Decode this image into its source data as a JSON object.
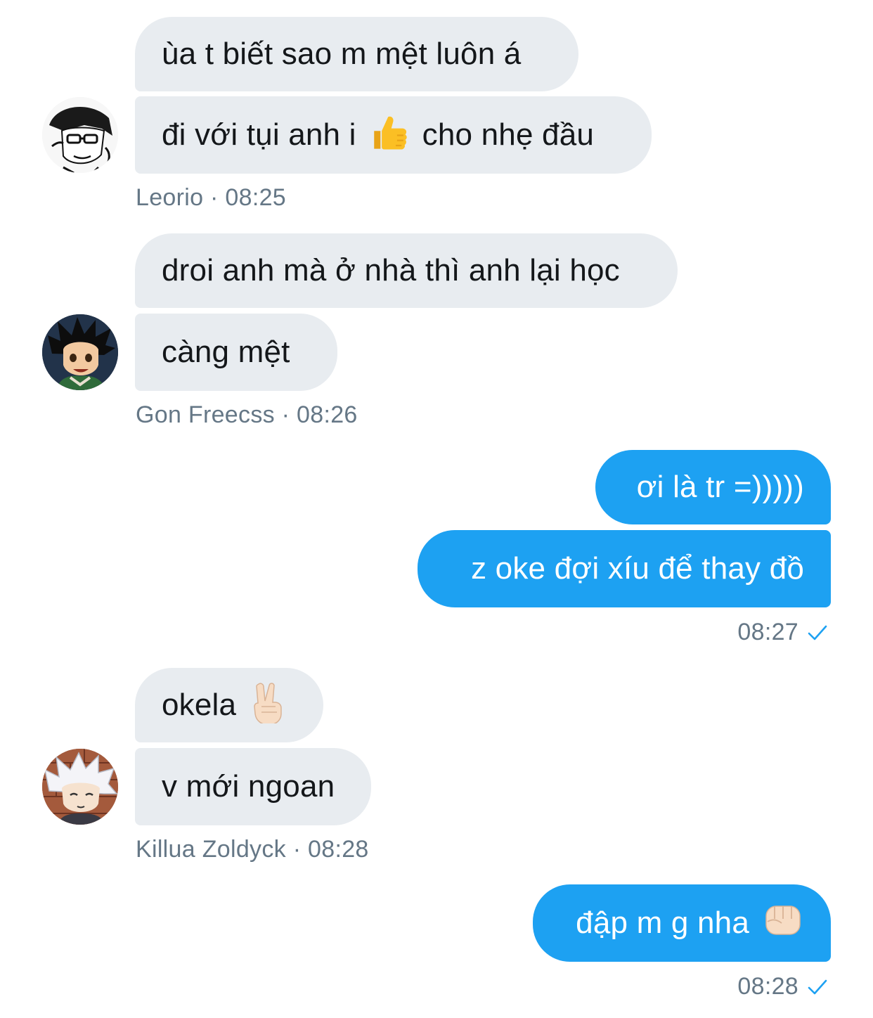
{
  "conversation": {
    "groups": [
      {
        "sender": "Leorio",
        "time": "08:25",
        "meta": "Leorio · 08:25",
        "messages": [
          "ùa t biết sao m mệt luôn á",
          {
            "before": "đi với tụi anh i",
            "emoji": "thumbs-up-icon",
            "after": "cho nhẹ đầu"
          }
        ]
      },
      {
        "sender": "Gon Freecss",
        "time": "08:26",
        "meta": "Gon Freecss · 08:26",
        "messages": [
          "droi anh mà ở nhà thì anh lại học",
          "càng mệt"
        ]
      },
      {
        "sender": "me",
        "time": "08:27",
        "messages": [
          "ơi là tr =)))))",
          "z oke đợi xíu để thay đồ"
        ]
      },
      {
        "sender": "Killua Zoldyck",
        "time": "08:28",
        "meta": "Killua Zoldyck · 08:28",
        "messages": [
          {
            "before": "okela",
            "emoji": "victory-hand-icon"
          },
          "v mới ngoan"
        ]
      },
      {
        "sender": "me",
        "time": "08:28",
        "messages": [
          {
            "before": "đập m g nha",
            "emoji": "fist-bump-icon"
          }
        ]
      }
    ]
  },
  "colors": {
    "incoming_bubble": "#e8ecf0",
    "outgoing_bubble": "#1da1f2",
    "meta_text": "#657786",
    "read_check": "#1da1f2"
  }
}
